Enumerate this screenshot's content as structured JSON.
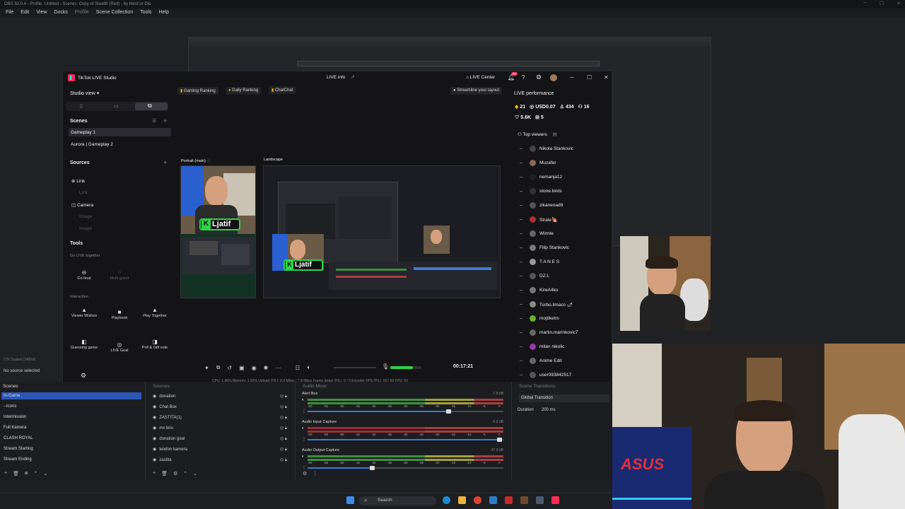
{
  "obs": {
    "title": "OBS 32.0.4 - Profile: Untitled - Scenes: Copy of Stealth (Red) - by Nerd or Die",
    "menu": [
      "File",
      "Edit",
      "View",
      "Docks",
      "Profile",
      "Scene Collection",
      "Tools",
      "Help"
    ],
    "no_source": "No source selected",
    "scaled_text": "77%    Scaled (1480x8",
    "status_line": "CPU: 1.96%      Memory: 1.53%      Upload (P/L): 8.9 Mbps / 7.9 Mbps      Frame drops (P/L): 0 / 0      Encoder FPS (P/L): 60 / 60      FPS: 60"
  },
  "tiktok": {
    "app_name": "TikTok LIVE Studio",
    "live_info": "LIVE info",
    "live_center": "LIVE Center",
    "notif_count": "99",
    "studio_view": "Studio view",
    "rank_tabs": [
      "Gaming Ranking",
      "Daily Ranking",
      "ChatChat"
    ],
    "streamline": "Streamline your layout",
    "scenes_label": "Scenes",
    "scenes": [
      "Gameplay 1",
      "Aurora | Gameplay 2"
    ],
    "sources_label": "Sources",
    "sources": [
      "Link",
      "Link",
      "Camera",
      "Image",
      "Image"
    ],
    "tools_label": "Tools",
    "go_live_together": "Go LIVE together",
    "cohost": "Co-host",
    "multiguest": "Multi-guest",
    "interaction": "Interaction",
    "tools": [
      {
        "label": "Viewer Wishes",
        "icon": "▲"
      },
      {
        "label": "Playbook",
        "icon": "■"
      },
      {
        "label": "Play Together",
        "icon": "▲"
      },
      {
        "label": "Guessing game",
        "icon": "◧"
      },
      {
        "label": "LIVE Goal",
        "icon": "◎"
      },
      {
        "label": "Poll & Gift vote",
        "icon": "◨"
      }
    ],
    "portrait_label": "Portrait (main)",
    "landscape_label": "Landscape",
    "overlay_name": "Ljatif",
    "timer": "00:17:21",
    "performance": {
      "title": "LIVE performance",
      "diamonds": "21",
      "usd": "USD0.07",
      "viewers": "434",
      "new_followers": "16",
      "likes": "5.6K",
      "gifters": "5"
    },
    "top_viewers_label": "Top viewers",
    "top_viewers": [
      "Nikola Stankovic",
      "Muzafer",
      "nemanja12",
      "stone.birds",
      "zikanenad9",
      "Strale🍖",
      "Winnie",
      "Filip Stankovic",
      "T A N E S",
      "DZ.L",
      "KireA4ko",
      "Turbo.limacc 🌶",
      "mojtiketrs",
      "martin.marinkovic7",
      "milan nikolic",
      "Anime Edit",
      "user093842517"
    ]
  },
  "scenes_dock": {
    "title": "Scenes",
    "items": [
      "In-Game",
      "--Icons",
      "Intermission",
      "Full Kamera",
      "CLASH ROYAL",
      "Stream Starting",
      "Stream Ending"
    ],
    "selected": "In-Game"
  },
  "sources_dock": {
    "title": "Sources",
    "items": [
      "donation",
      "Chat Box",
      "ZASTITA(1)",
      "mx brio",
      "donation goal",
      "telefon kamera",
      "zastita"
    ]
  },
  "mixer": {
    "title": "Audio Mixer",
    "channels": [
      {
        "name": "Alert Box",
        "db": "-7.8 dB",
        "level": 0.72
      },
      {
        "name": "Audio Input Capture",
        "db": "-0.6 dB",
        "level": 0.98
      },
      {
        "name": "Audio Output Capture",
        "db": "-37.6 dB",
        "level": 0.33
      }
    ],
    "ticks": [
      "-60",
      "-55",
      "-50",
      "-45",
      "-40",
      "-35",
      "-30",
      "-25",
      "-20",
      "-15",
      "-10",
      "-5",
      "0"
    ]
  },
  "transitions": {
    "title": "Scene Transitions",
    "mode": "Global Transition",
    "duration_label": "Duration",
    "duration_value": "200 ms"
  },
  "taskbar": {
    "search": "Search"
  },
  "colors": {
    "accent": "#2d56b5",
    "tiktok_red": "#fe2c55",
    "tiktok_cyan": "#25f4ee",
    "overlay_green": "#2bd44a"
  }
}
